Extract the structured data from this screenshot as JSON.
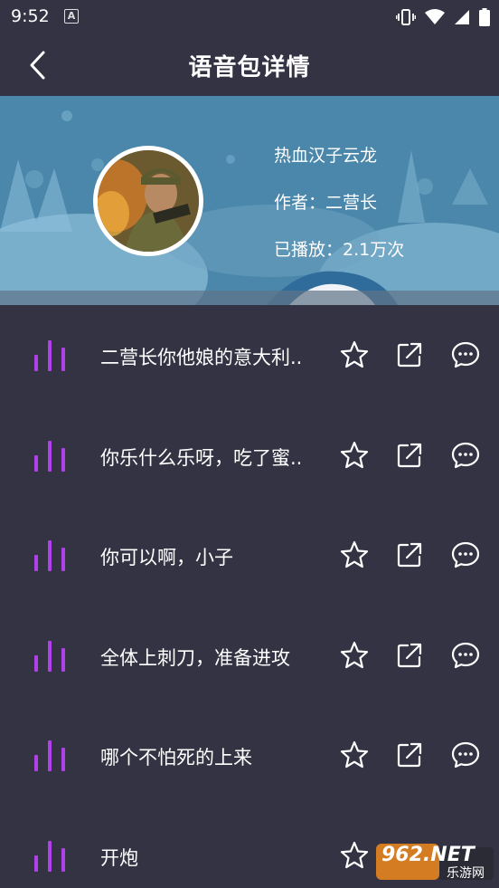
{
  "status": {
    "time": "9:52",
    "notification_glyph": "A"
  },
  "header": {
    "title": "语音包详情"
  },
  "pack": {
    "name": "热血汉子云龙",
    "author": "作者：二营长",
    "plays": "已播放：2.1万次"
  },
  "clips": [
    {
      "title": "二营长你他娘的意大利.."
    },
    {
      "title": "你乐什么乐呀，吃了蜜.."
    },
    {
      "title": "你可以啊，小子"
    },
    {
      "title": "全体上刺刀，准备进攻"
    },
    {
      "title": "哪个不怕死的上来"
    },
    {
      "title": "开炮"
    }
  ],
  "colors": {
    "background": "#333344",
    "accent": "#b040e8",
    "banner": "#4a8ab0"
  },
  "icons": [
    "back-icon",
    "sound-bars-icon",
    "star-icon",
    "share-icon",
    "comment-icon",
    "vibrate-icon",
    "wifi-icon",
    "signal-icon",
    "battery-icon"
  ],
  "watermark": {
    "text": "962.NET",
    "sub": "乐游网"
  }
}
